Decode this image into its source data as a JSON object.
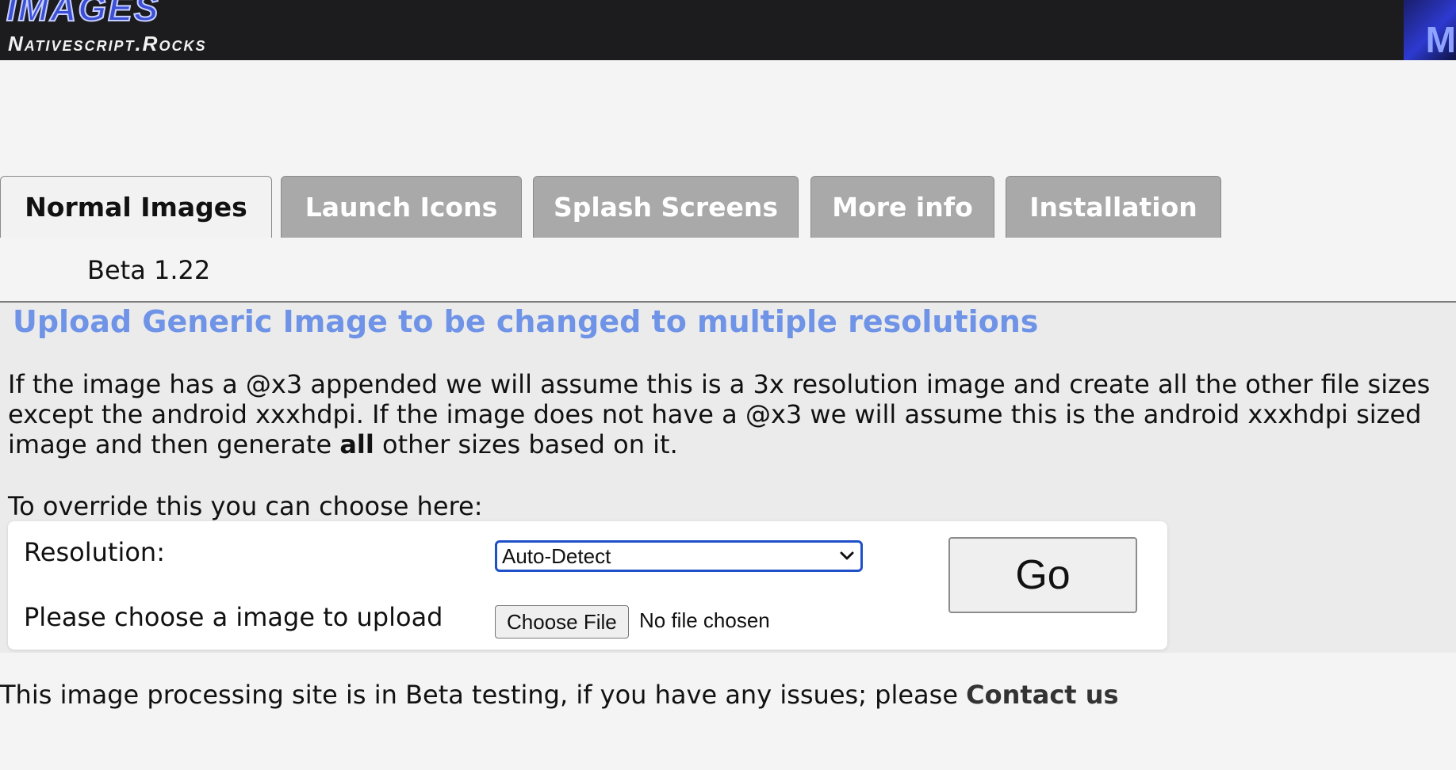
{
  "header": {
    "logo_title": "Images",
    "logo_subtitle": "Nativescript.Rocks",
    "corner_logo": "M"
  },
  "tabs": [
    {
      "label": "Normal Images",
      "active": true
    },
    {
      "label": "Launch Icons",
      "active": false
    },
    {
      "label": "Splash Screens",
      "active": false
    },
    {
      "label": "More info",
      "active": false
    },
    {
      "label": "Installation",
      "active": false
    }
  ],
  "version": "Beta 1.22",
  "main": {
    "heading": "Upload Generic Image to be changed to multiple resolutions",
    "desc_part1": "If the image has a @x3 appended we will assume this is a 3x resolution image and create all the other file sizes except the android xxxhdpi. If the image does not have a @x3 we will assume this is the android xxxhdpi sized image and then generate ",
    "desc_bold": "all",
    "desc_part2": " other sizes based on it.",
    "override_text": "To override this you can choose here:"
  },
  "form": {
    "resolution_label": "Resolution:",
    "resolution_value": "Auto-Detect",
    "upload_label": "Please choose a image to upload",
    "file_button": "Choose File",
    "file_status": "No file chosen",
    "go_button": "Go"
  },
  "footer": {
    "text": "This image processing site is in Beta testing, if you have any issues; please ",
    "link": "Contact us"
  },
  "colors": {
    "header_bg": "#1c1c1e",
    "heading": "#6f93e6",
    "tab_inactive": "#a9a9a9",
    "select_border": "#1f50c8"
  },
  "icons": {
    "select_arrow": "chevron-down-icon"
  }
}
